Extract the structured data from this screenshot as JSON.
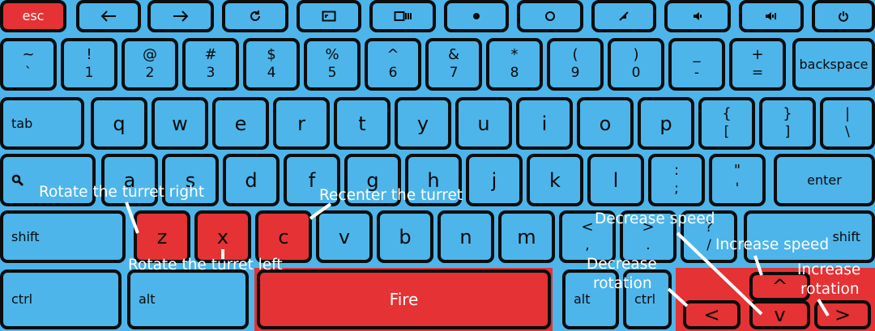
{
  "colors": {
    "key_fill": "#4db5ea",
    "highlight": "#e53234",
    "outline": "#0c0c0c",
    "annotation_text": "#ffffff"
  },
  "rows": {
    "r1": [
      {
        "id": "esc",
        "label": "esc",
        "red": true
      },
      {
        "id": "back",
        "icon": "arrow-left-icon"
      },
      {
        "id": "forward",
        "icon": "arrow-right-icon"
      },
      {
        "id": "refresh",
        "icon": "refresh-icon"
      },
      {
        "id": "fullscreen",
        "icon": "fullscreen-icon"
      },
      {
        "id": "overview",
        "icon": "overview-icon"
      },
      {
        "id": "brightness-down",
        "icon": "brightness-down-icon"
      },
      {
        "id": "brightness-up",
        "icon": "brightness-up-icon"
      },
      {
        "id": "mute",
        "icon": "mute-icon"
      },
      {
        "id": "volume-down",
        "icon": "volume-down-icon"
      },
      {
        "id": "volume-up",
        "icon": "volume-up-icon"
      },
      {
        "id": "power",
        "icon": "power-icon"
      }
    ],
    "r2": [
      {
        "id": "tilde",
        "top": "~",
        "bottom": "`"
      },
      {
        "id": "1",
        "top": "!",
        "bottom": "1"
      },
      {
        "id": "2",
        "top": "@",
        "bottom": "2"
      },
      {
        "id": "3",
        "top": "#",
        "bottom": "3"
      },
      {
        "id": "4",
        "top": "$",
        "bottom": "4"
      },
      {
        "id": "5",
        "top": "%",
        "bottom": "5"
      },
      {
        "id": "6",
        "top": "^",
        "bottom": "6"
      },
      {
        "id": "7",
        "top": "&",
        "bottom": "7"
      },
      {
        "id": "8",
        "top": "*",
        "bottom": "8"
      },
      {
        "id": "9",
        "top": "(",
        "bottom": "9"
      },
      {
        "id": "0",
        "top": ")",
        "bottom": "0"
      },
      {
        "id": "minus",
        "top": "_",
        "bottom": "-"
      },
      {
        "id": "equals",
        "top": "+",
        "bottom": "="
      },
      {
        "id": "backspace",
        "label": "backspace"
      }
    ],
    "r3": [
      {
        "id": "tab",
        "label": "tab"
      },
      {
        "id": "q",
        "label": "q"
      },
      {
        "id": "w",
        "label": "w"
      },
      {
        "id": "e",
        "label": "e"
      },
      {
        "id": "r",
        "label": "r"
      },
      {
        "id": "t",
        "label": "t"
      },
      {
        "id": "y",
        "label": "y"
      },
      {
        "id": "u",
        "label": "u"
      },
      {
        "id": "i",
        "label": "i"
      },
      {
        "id": "o",
        "label": "o"
      },
      {
        "id": "p",
        "label": "p"
      },
      {
        "id": "lbracket",
        "top": "{",
        "bottom": "["
      },
      {
        "id": "rbracket",
        "top": "}",
        "bottom": "]"
      },
      {
        "id": "backslash",
        "top": "|",
        "bottom": "\\"
      }
    ],
    "r4": [
      {
        "id": "search",
        "icon": "search-icon"
      },
      {
        "id": "a",
        "label": "a"
      },
      {
        "id": "s",
        "label": "s"
      },
      {
        "id": "d",
        "label": "d"
      },
      {
        "id": "f",
        "label": "f"
      },
      {
        "id": "g",
        "label": "g"
      },
      {
        "id": "h",
        "label": "h"
      },
      {
        "id": "j",
        "label": "j"
      },
      {
        "id": "k",
        "label": "k"
      },
      {
        "id": "l",
        "label": "l"
      },
      {
        "id": "semicolon",
        "top": ":",
        "bottom": ";"
      },
      {
        "id": "quote",
        "top": "\"",
        "bottom": "'"
      },
      {
        "id": "enter",
        "label": "enter"
      }
    ],
    "r5": [
      {
        "id": "shift-left",
        "label": "shift"
      },
      {
        "id": "z",
        "label": "z",
        "red": true
      },
      {
        "id": "x",
        "label": "x",
        "red": true
      },
      {
        "id": "c",
        "label": "c",
        "red": true
      },
      {
        "id": "v",
        "label": "v"
      },
      {
        "id": "b",
        "label": "b"
      },
      {
        "id": "n",
        "label": "n"
      },
      {
        "id": "m",
        "label": "m"
      },
      {
        "id": "comma",
        "top": "<",
        "bottom": ","
      },
      {
        "id": "period",
        "top": ">",
        "bottom": "."
      },
      {
        "id": "slash",
        "top": "?",
        "bottom": "/"
      },
      {
        "id": "shift-right",
        "label": "shift"
      }
    ],
    "r6": [
      {
        "id": "ctrl-left",
        "label": "ctrl"
      },
      {
        "id": "alt-left",
        "label": "alt"
      },
      {
        "id": "space",
        "label": "Fire",
        "red": true
      },
      {
        "id": "alt-right",
        "label": "alt"
      },
      {
        "id": "ctrl-right",
        "label": "ctrl"
      },
      {
        "id": "arrow-left",
        "label": "<",
        "red": true
      },
      {
        "id": "arrow-up",
        "label": "^",
        "red": true
      },
      {
        "id": "arrow-down",
        "label": "v",
        "red": true
      },
      {
        "id": "arrow-right",
        "label": ">",
        "red": true
      }
    ]
  },
  "annotations": {
    "rotate_right": "Rotate the turret right",
    "rotate_left": "Rotate the turret left",
    "recenter": "Recenter the turret",
    "decrease_speed": "Decrease speed",
    "increase_speed": "Increase speed",
    "decrease_rotation_1": "Decrease",
    "decrease_rotation_2": "rotation",
    "increase_rotation_1": "Increase",
    "increase_rotation_2": "rotation"
  }
}
